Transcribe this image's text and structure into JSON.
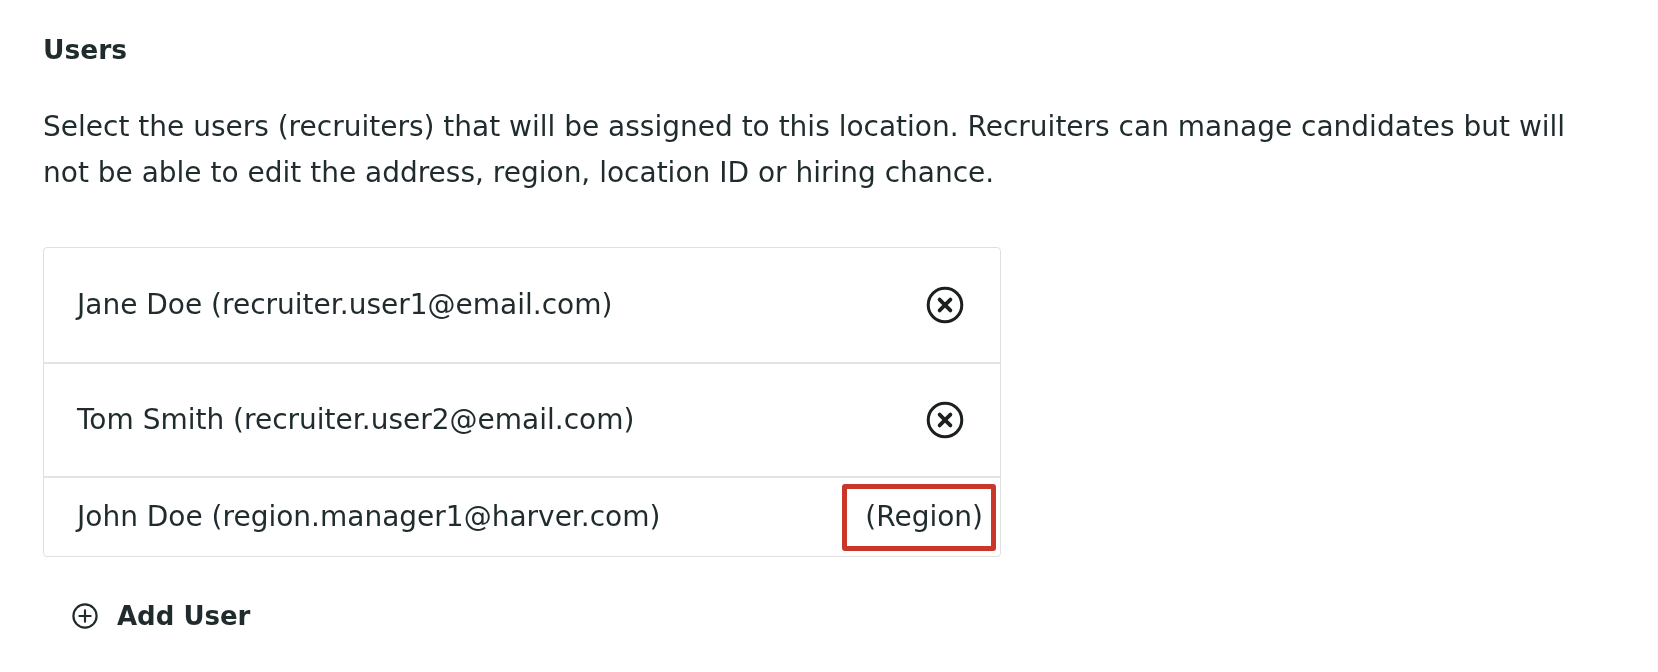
{
  "section": {
    "title": "Users",
    "description": "Select the users (recruiters) that will be assigned to this location. Recruiters can manage candidates but will not be able to edit the address, region, location ID or hiring chance."
  },
  "users": [
    {
      "label": "Jane Doe (recruiter.user1@email.com)",
      "kind": "removable",
      "highlighted": false
    },
    {
      "label": "Tom Smith (recruiter.user2@email.com)",
      "kind": "removable",
      "highlighted": false
    },
    {
      "label": "John Doe (region.manager1@harver.com)",
      "kind": "tagged",
      "tag": "(Region)",
      "highlighted": true
    }
  ],
  "add_button": {
    "label": "Add User"
  }
}
